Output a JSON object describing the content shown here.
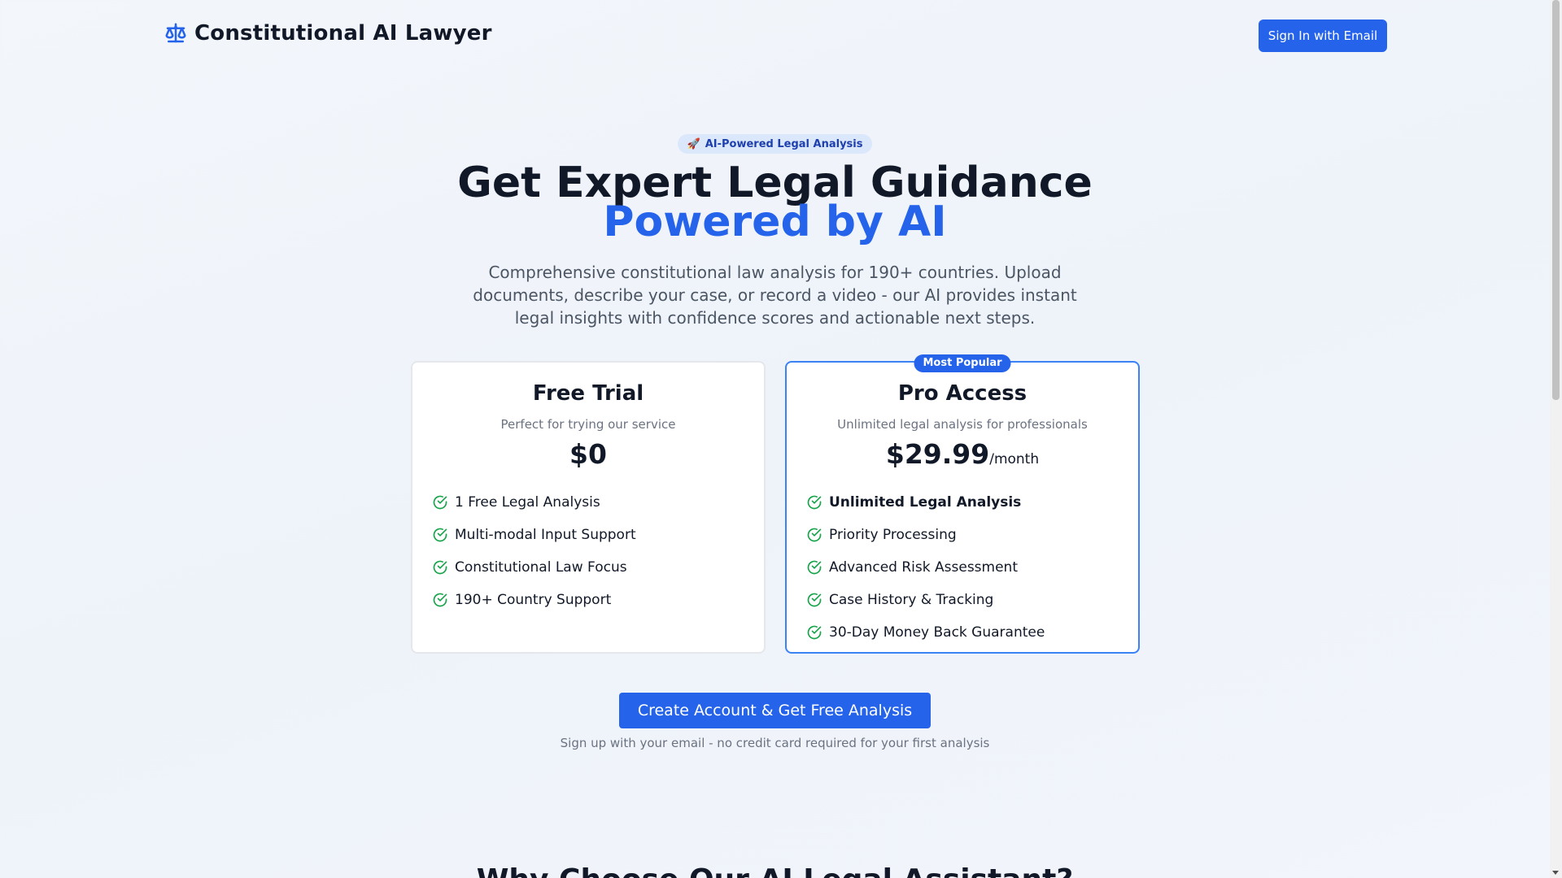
{
  "header": {
    "brand_icon": "scale-icon",
    "brand_title": "Constitutional AI Lawyer",
    "signin_label": "Sign In with Email"
  },
  "hero": {
    "badge_icon": "rocket-icon",
    "badge_emoji": "🚀",
    "badge_text": "AI-Powered Legal Analysis",
    "headline_line1": "Get Expert Legal Guidance",
    "headline_line2": "Powered by AI",
    "subtitle": "Comprehensive constitutional law analysis for 190+ countries. Upload documents, describe your case, or record a video - our AI provides instant legal insights with confidence scores and actionable next steps."
  },
  "plans": {
    "free": {
      "name": "Free Trial",
      "description": "Perfect for trying our service",
      "price": "$0",
      "features": [
        "1 Free Legal Analysis",
        "Multi-modal Input Support",
        "Constitutional Law Focus",
        "190+ Country Support"
      ]
    },
    "pro": {
      "badge": "Most Popular",
      "name": "Pro Access",
      "description": "Unlimited legal analysis for professionals",
      "price": "$29.99",
      "period": "/month",
      "features": [
        "Unlimited Legal Analysis",
        "Priority Processing",
        "Advanced Risk Assessment",
        "Case History & Tracking",
        "30-Day Money Back Guarantee"
      ]
    }
  },
  "cta": {
    "label": "Create Account & Get Free Analysis",
    "note": "Sign up with your email - no credit card required for your first analysis"
  },
  "next_section": {
    "title": "Why Choose Our AI Legal Assistant?"
  },
  "colors": {
    "accent": "#2563eb",
    "check": "#16a34a",
    "text": "#111827",
    "muted": "#6b7280"
  }
}
